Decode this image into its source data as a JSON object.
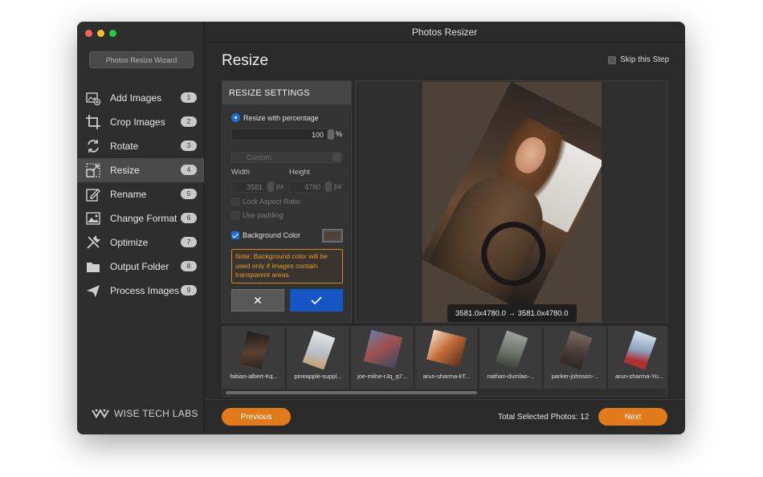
{
  "app": {
    "title": "Photos Resizer"
  },
  "sidebar": {
    "wizard_button": "Photos Resize Wizard",
    "items": [
      {
        "label": "Add Images",
        "badge": "1",
        "icon": "add-images-icon"
      },
      {
        "label": "Crop Images",
        "badge": "2",
        "icon": "crop-icon"
      },
      {
        "label": "Rotate",
        "badge": "3",
        "icon": "rotate-icon"
      },
      {
        "label": "Resize",
        "badge": "4",
        "icon": "resize-icon",
        "active": true
      },
      {
        "label": "Rename",
        "badge": "5",
        "icon": "rename-icon"
      },
      {
        "label": "Change Format",
        "badge": "6",
        "icon": "image-format-icon"
      },
      {
        "label": "Optimize",
        "badge": "7",
        "icon": "tools-icon"
      },
      {
        "label": "Output Folder",
        "badge": "8",
        "icon": "folder-icon"
      },
      {
        "label": "Process Images",
        "badge": "9",
        "icon": "send-icon"
      }
    ],
    "brand": "WISE TECH LABS"
  },
  "main": {
    "title": "Resize",
    "skip_label": "Skip this Step",
    "skip_checked": false
  },
  "settings": {
    "header": "RESIZE SETTINGS",
    "percentage_label": "Resize with percentage",
    "percentage_value": "100",
    "percent_sign": "%",
    "custom_label": "Custom",
    "width_label": "Width",
    "height_label": "Height",
    "width_value": "3581",
    "height_value": "4780",
    "px_unit": "px",
    "lock_aspect_label": "Lock Aspect Ratio",
    "use_padding_label": "Use padding",
    "background_color_label": "Background Color",
    "background_color": "#4d4138",
    "note": "Note: Background color will be used only if images contain transparent areas.",
    "cancel_symbol": "✕",
    "confirm_symbol": "✓"
  },
  "preview": {
    "dimensions": "3581.0x4780.0 → 3581.0x4780.0"
  },
  "thumbnails": [
    {
      "name": "fabian-albert-Kq...",
      "tone": "#3a2e26"
    },
    {
      "name": "pineapple-suppl...",
      "tone": "#c9cdd2"
    },
    {
      "name": "joe-milne-rJq_q7...",
      "tone": "#5a6b86"
    },
    {
      "name": "arun-sharma-kT...",
      "tone": "#b86a3c"
    },
    {
      "name": "nathan-dumlao-...",
      "tone": "#8a8f8a"
    },
    {
      "name": "parker-johnson-...",
      "tone": "#6e5c58"
    },
    {
      "name": "arun-sharma-Yu...",
      "tone": "#9fb4cc"
    }
  ],
  "footer": {
    "previous": "Previous",
    "next": "Next",
    "total_selected": "Total Selected Photos: 12"
  },
  "colors": {
    "accent": "#e07a1a",
    "primary_blue": "#1655c4",
    "note_orange": "#e89b2a"
  }
}
